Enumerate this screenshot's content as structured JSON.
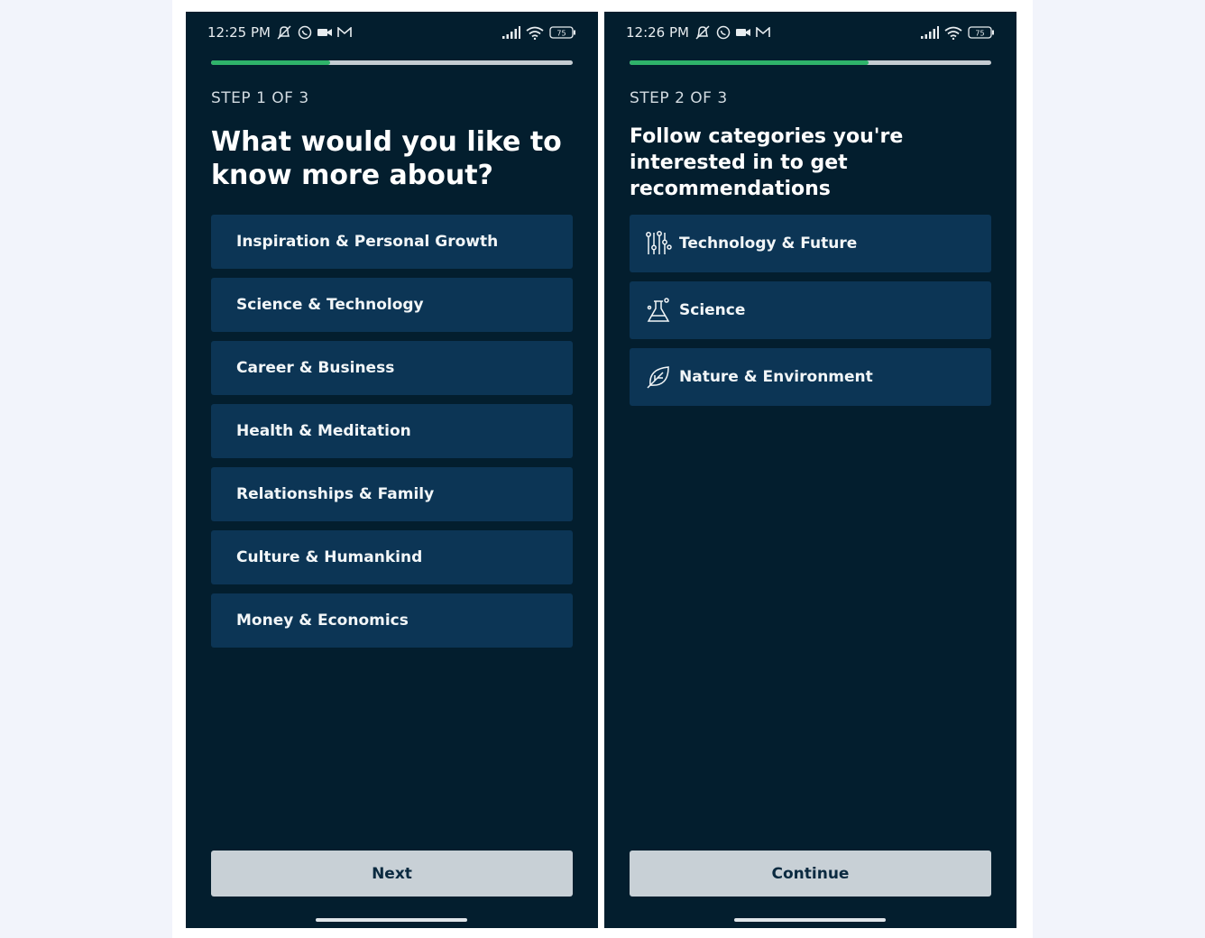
{
  "colors": {
    "page_bg": "#f2f4fb",
    "screen_bg": "#031e2e",
    "option_bg": "#0c3555",
    "progress_fill": "#2fb36a",
    "progress_track": "#c4ccd2",
    "button_bg": "#c8d0d6",
    "button_text": "#0b2a40"
  },
  "screen1": {
    "status": {
      "time": "12:25 PM",
      "battery": "75",
      "icons": [
        "mute-icon",
        "whatsapp-icon",
        "video-icon",
        "gmail-icon",
        "signal-icon",
        "wifi-icon",
        "battery-icon"
      ]
    },
    "progress": 0.33,
    "step": "STEP 1 OF 3",
    "title": "What would you like to know more about?",
    "options": [
      "Inspiration & Personal Growth",
      "Science & Technology",
      "Career & Business",
      "Health & Meditation",
      "Relationships & Family",
      "Culture & Humankind",
      "Money & Economics"
    ],
    "button": "Next"
  },
  "screen2": {
    "status": {
      "time": "12:26 PM",
      "battery": "75",
      "icons": [
        "mute-icon",
        "whatsapp-icon",
        "video-icon",
        "gmail-icon",
        "signal-icon",
        "wifi-icon",
        "battery-icon"
      ]
    },
    "progress": 0.66,
    "step": "STEP 2 OF 3",
    "title": "Follow categories you're interested in to get recommendations",
    "categories": [
      {
        "label": "Technology & Future",
        "icon": "circuit-icon"
      },
      {
        "label": "Science",
        "icon": "flask-icon"
      },
      {
        "label": "Nature & Environment",
        "icon": "leaf-icon"
      }
    ],
    "button": "Continue"
  }
}
